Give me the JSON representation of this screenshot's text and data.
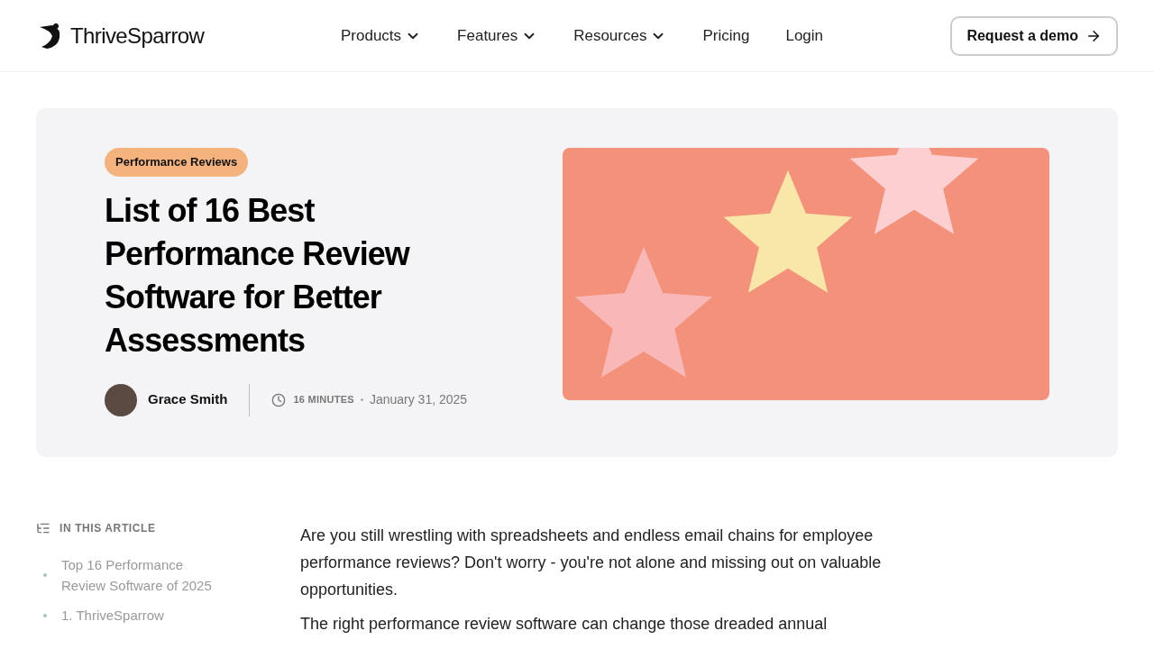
{
  "header": {
    "brand": "ThriveSparrow",
    "nav": [
      {
        "label": "Products",
        "dropdown": true
      },
      {
        "label": "Features",
        "dropdown": true
      },
      {
        "label": "Resources",
        "dropdown": true
      },
      {
        "label": "Pricing",
        "dropdown": false
      },
      {
        "label": "Login",
        "dropdown": false
      }
    ],
    "cta": "Request a demo"
  },
  "hero": {
    "tag": "Performance Reviews",
    "title": "List of 16 Best Performance Review Software for Better Assessments",
    "author": "Grace Smith",
    "read_time": "16 MINUTES",
    "date": "January 31, 2025"
  },
  "toc": {
    "heading": "IN THIS ARTICLE",
    "items": [
      "Top 16 Performance Review Software of 2025",
      "1. ThriveSparrow"
    ]
  },
  "article": {
    "paragraphs": [
      "Are you still wrestling with spreadsheets and endless email chains for employee performance reviews? Don't worry - you're not alone and missing out on valuable opportunities.",
      "The right performance review software can change those dreaded annual"
    ]
  }
}
